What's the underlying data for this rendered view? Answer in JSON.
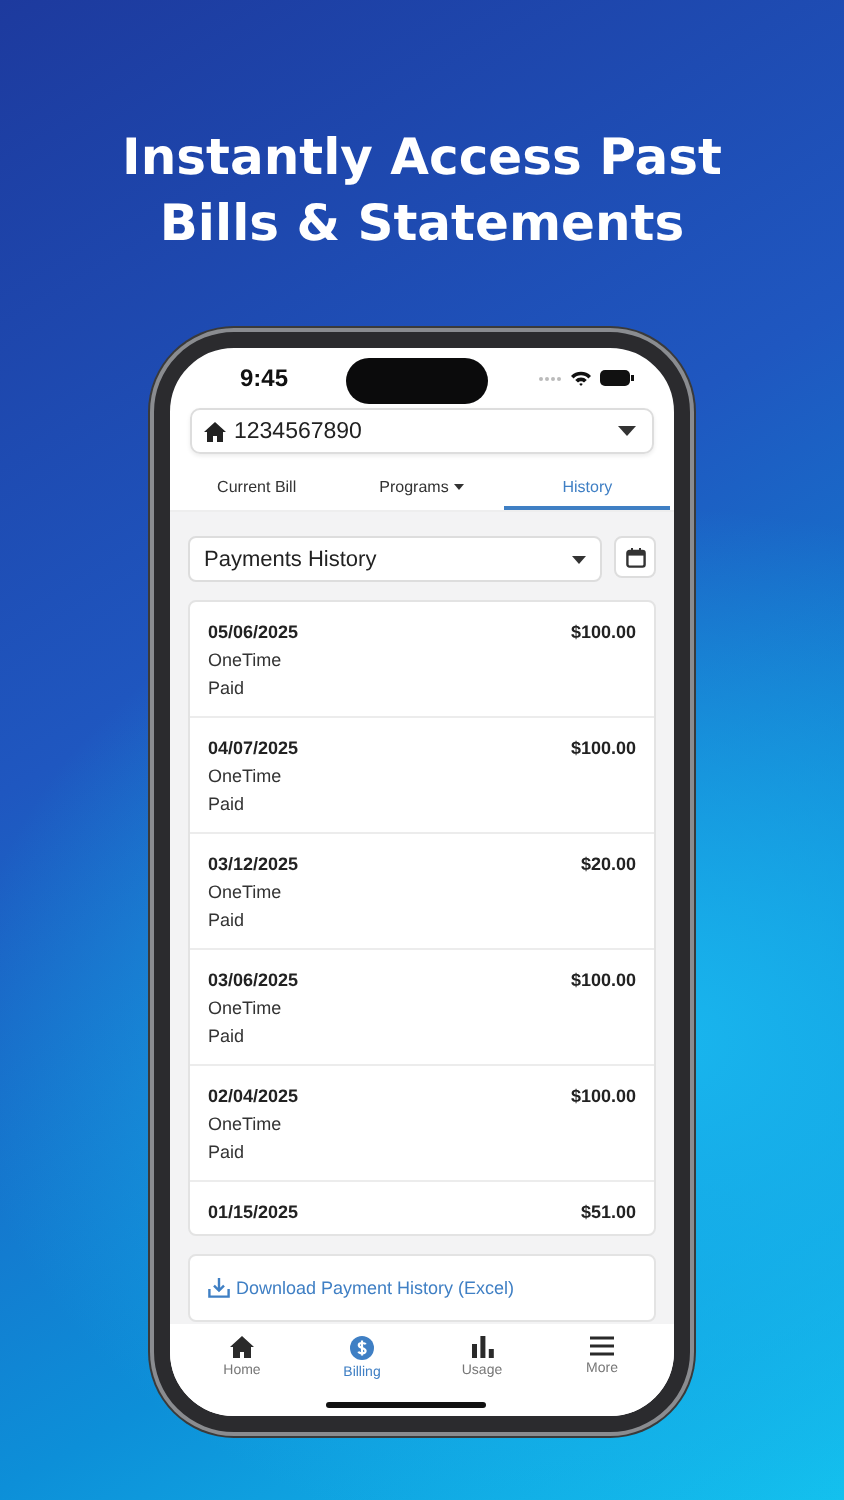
{
  "headline": [
    "Instantly Access Past",
    "Bills & Statements"
  ],
  "status_bar": {
    "time": "9:45"
  },
  "account": {
    "number": "1234567890"
  },
  "tabs": [
    {
      "label": "Current Bill",
      "selected": false,
      "has_menu": false
    },
    {
      "label": "Programs",
      "selected": false,
      "has_menu": true
    },
    {
      "label": "History",
      "selected": true,
      "has_menu": false
    }
  ],
  "filter": {
    "value": "Payments History"
  },
  "payments": [
    {
      "date": "05/06/2025",
      "amount": "$100.00",
      "type": "OneTime",
      "status": "Paid"
    },
    {
      "date": "04/07/2025",
      "amount": "$100.00",
      "type": "OneTime",
      "status": "Paid"
    },
    {
      "date": "03/12/2025",
      "amount": "$20.00",
      "type": "OneTime",
      "status": "Paid"
    },
    {
      "date": "03/06/2025",
      "amount": "$100.00",
      "type": "OneTime",
      "status": "Paid"
    },
    {
      "date": "02/04/2025",
      "amount": "$100.00",
      "type": "OneTime",
      "status": "Paid"
    },
    {
      "date": "01/15/2025",
      "amount": "$51.00"
    }
  ],
  "download_link": "Download Payment History (Excel)",
  "nav": [
    {
      "label": "Home",
      "selected": false
    },
    {
      "label": "Billing",
      "selected": true
    },
    {
      "label": "Usage",
      "selected": false
    },
    {
      "label": "More",
      "selected": false
    }
  ]
}
